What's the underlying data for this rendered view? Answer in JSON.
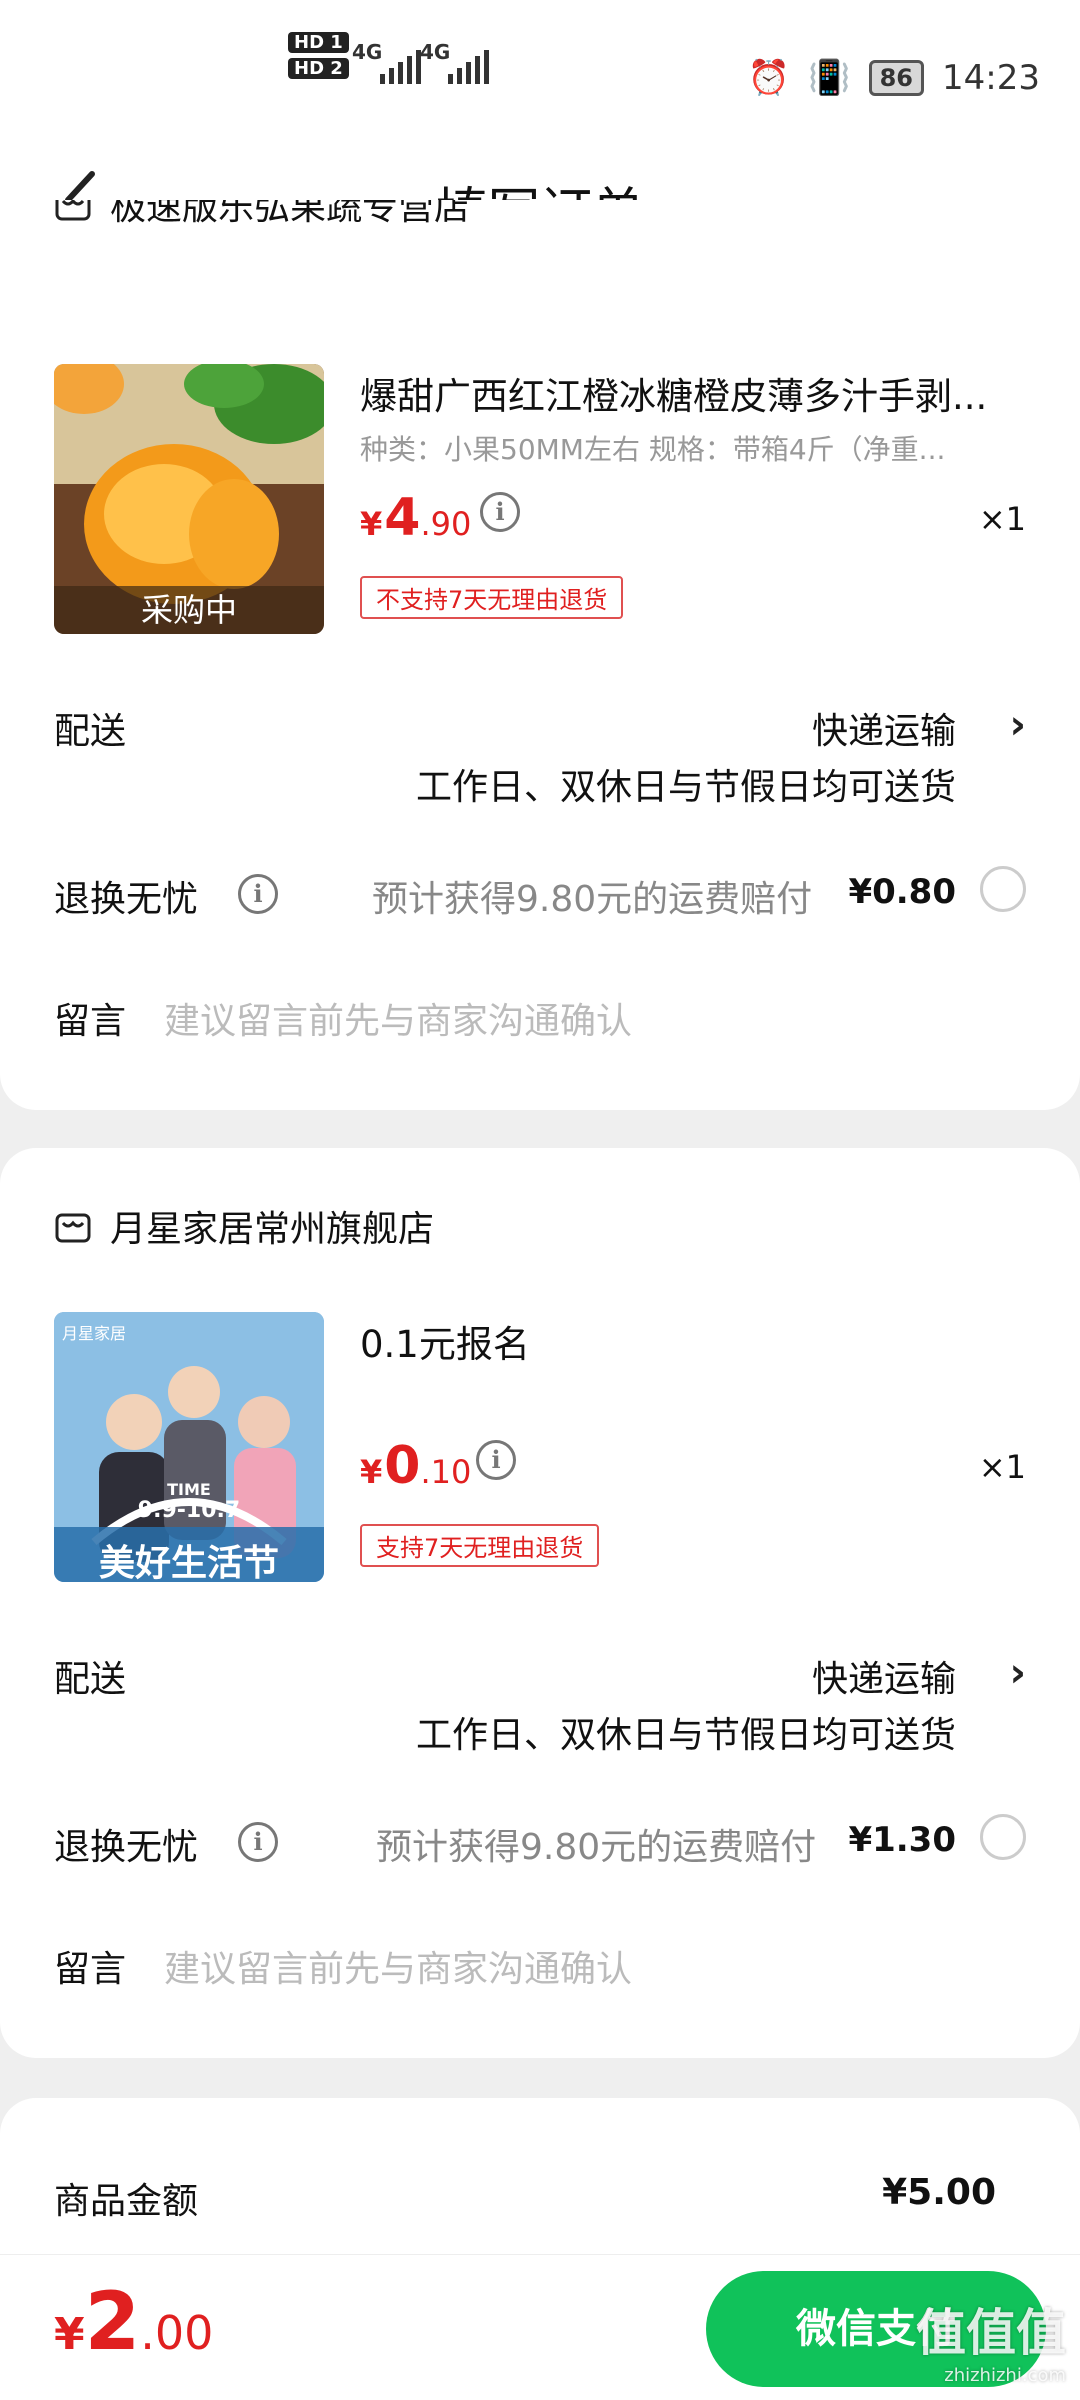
{
  "status_bar": {
    "hd1": "HD 1",
    "hd2": "HD 2",
    "net1": "4G",
    "net2": "4G",
    "battery": "86",
    "time": "14:23"
  },
  "nav": {
    "title": "填写订单"
  },
  "store1": {
    "name": "极速版乐弘果蔬专营店",
    "product": {
      "title": "爆甜广西红江橙冰糖橙皮薄多汁手剥...",
      "spec": "种类：小果50MM左右   规格：带箱4斤（净重...",
      "thumb_caption": "采购中",
      "price_symbol": "¥",
      "price_int": "4",
      "price_dec": ".90",
      "qty": "×1",
      "tag": "不支持7天无理由退货"
    },
    "delivery_label": "配送",
    "delivery_method": "快递运输",
    "delivery_note": "工作日、双休日与节假日均可送货",
    "compensation_label": "退换无忧",
    "compensation_text": "预计获得9.80元的运费赔付",
    "compensation_price": "¥0.80",
    "message_label": "留言",
    "message_placeholder": "建议留言前先与商家沟通确认"
  },
  "store2": {
    "name": "月星家居常州旗舰店",
    "product": {
      "title": "0.1元报名",
      "thumb_brand": "月星家居",
      "thumb_time": "TIME",
      "thumb_dates": "9.9-10.7",
      "thumb_slogan": "美好生活节",
      "price_symbol": "¥",
      "price_int": "0",
      "price_dec": ".10",
      "qty": "×1",
      "tag": "支持7天无理由退货"
    },
    "delivery_label": "配送",
    "delivery_method": "快递运输",
    "delivery_note": "工作日、双休日与节假日均可送货",
    "compensation_label": "退换无忧",
    "compensation_text": "预计获得9.80元的运费赔付",
    "compensation_price": "¥1.30",
    "message_label": "留言",
    "message_placeholder": "建议留言前先与商家沟通确认"
  },
  "summary": {
    "goods_amount_label": "商品金额",
    "goods_amount": "¥5.00"
  },
  "bottom": {
    "total_symbol": "¥",
    "total_int": "2",
    "total_dec": ".00",
    "pay_label": "微信支付",
    "watermark": "值值值",
    "watermark_url": "zhizhizhi.com"
  },
  "colors": {
    "price_red": "#e02020",
    "pay_green": "#10c25a"
  }
}
